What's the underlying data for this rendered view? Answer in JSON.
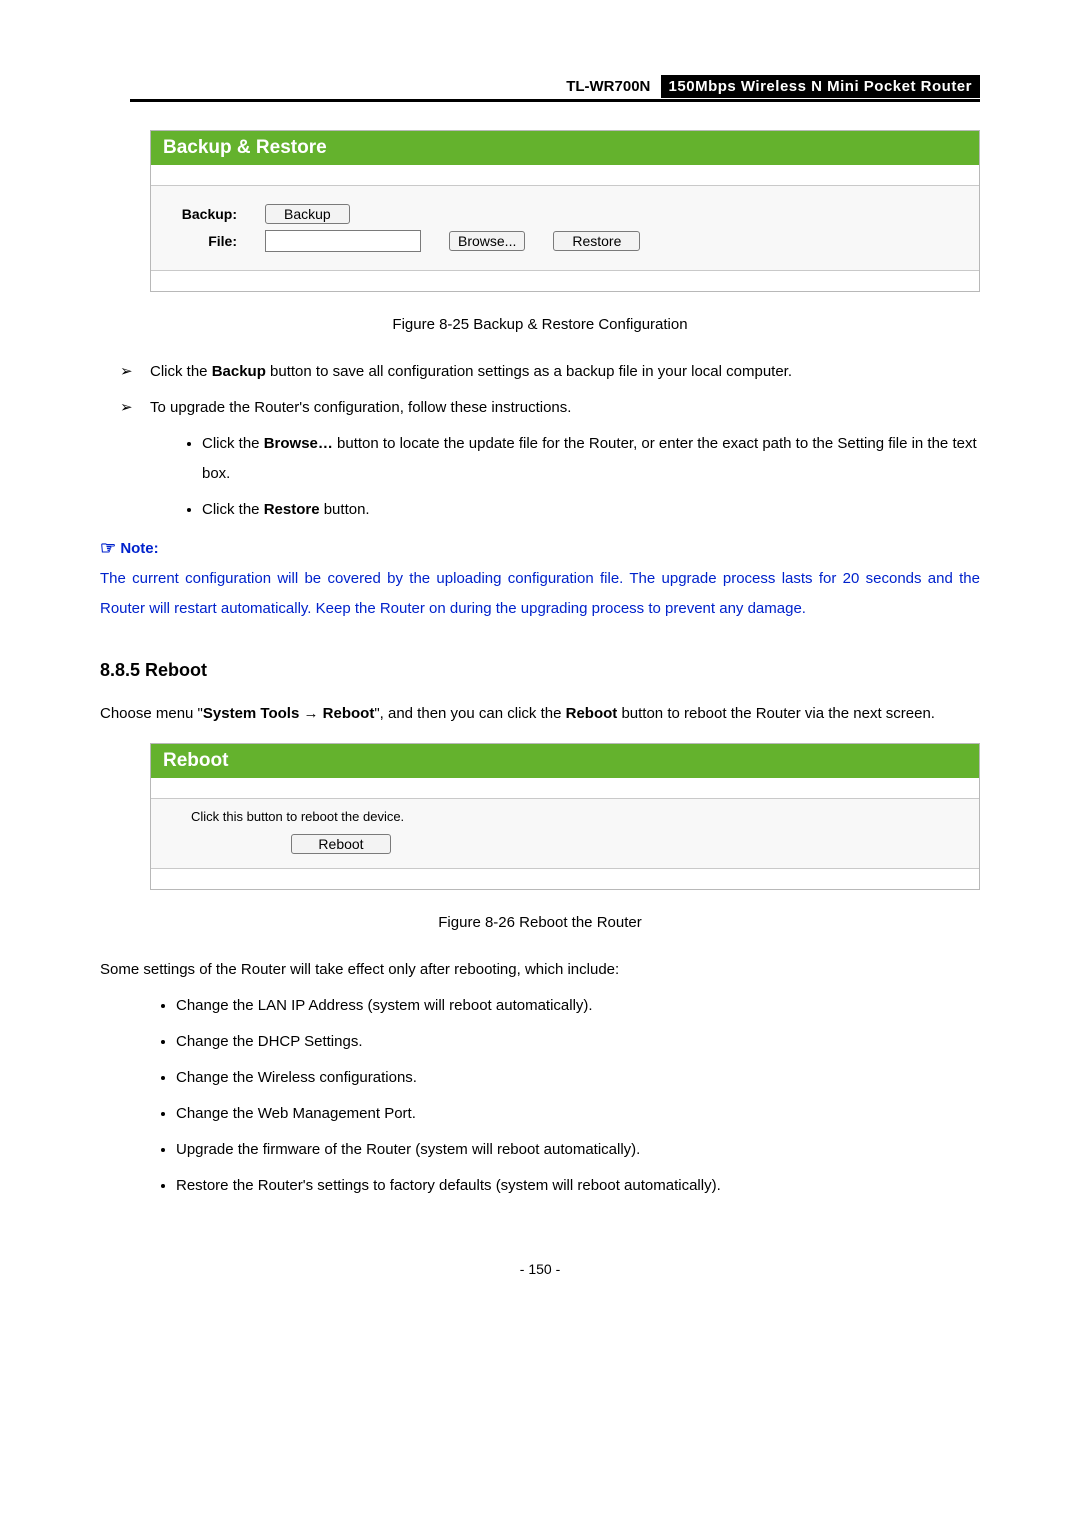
{
  "header": {
    "model": "TL-WR700N",
    "product": "150Mbps Wireless N Mini Pocket Router"
  },
  "panel1": {
    "title": "Backup & Restore",
    "backup_label": "Backup:",
    "file_label": "File:",
    "backup_btn": "Backup",
    "browse_btn": "Browse...",
    "restore_btn": "Restore",
    "file_value": ""
  },
  "caption1": "Figure 8-25    Backup & Restore Configuration",
  "bullets1": {
    "b1a": "Click the ",
    "b1b": "Backup",
    "b1c": " button to save all configuration settings as a backup file in your local computer.",
    "b2": "To upgrade the Router's configuration, follow these instructions.",
    "s1a": "Click the ",
    "s1b": "Browse…",
    "s1c": " button to locate the update file for the Router, or enter the exact path to the Setting file in the text box.",
    "s2a": "Click the ",
    "s2b": "Restore",
    "s2c": " button."
  },
  "note": {
    "heading": "Note:",
    "body": "The current configuration will be covered by the uploading configuration file. The upgrade process lasts for 20 seconds and the Router will restart automatically. Keep the Router on during the upgrading process to prevent any damage."
  },
  "section": {
    "heading": "8.8.5  Reboot",
    "intro_a": "Choose menu \"",
    "intro_b": "System Tools",
    "intro_arrow": " → ",
    "intro_c": "Reboot",
    "intro_d": "\", and then you can click the ",
    "intro_e": "Reboot",
    "intro_f": " button to reboot the Router via the next screen."
  },
  "panel2": {
    "title": "Reboot",
    "msg": "Click this button to reboot the device.",
    "btn": "Reboot"
  },
  "caption2": "Figure 8-26 Reboot the Router",
  "after": {
    "lead": "Some settings of the Router will take effect only after rebooting, which include:",
    "i1": "Change the LAN IP Address (system will reboot automatically).",
    "i2": "Change the DHCP Settings.",
    "i3": "Change the Wireless configurations.",
    "i4": "Change the Web Management Port.",
    "i5": "Upgrade the firmware of the Router (system will reboot automatically).",
    "i6": "Restore the Router's settings to factory defaults (system will reboot automatically)."
  },
  "page_number": "- 150 -"
}
